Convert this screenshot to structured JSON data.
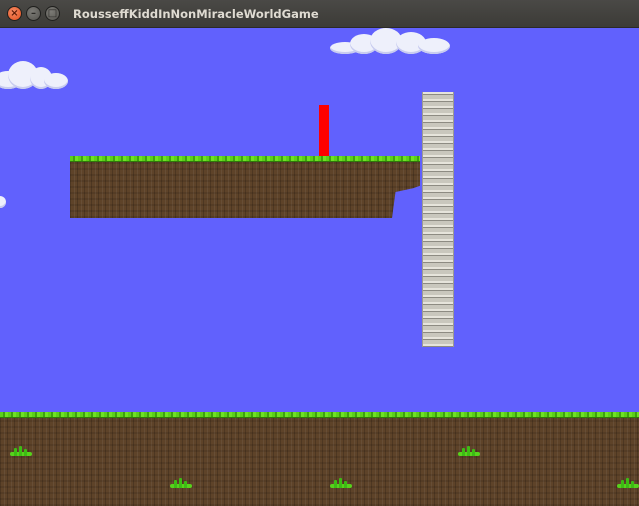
{
  "window": {
    "title": "RousseffKiddInNonMiracleWorldGame",
    "buttons": {
      "close_glyph": "×",
      "minimize_glyph": "–",
      "maximize_glyph": "□"
    }
  },
  "game": {
    "sky_color": "#6161fd",
    "player_color": "#fe0000",
    "grass_color": "#5ccf1a",
    "dirt_color": "#5e4329",
    "ladder_color": "#c9c7bd",
    "objects": [
      "cloud",
      "cloud",
      "cloud",
      "floating-platform",
      "player",
      "ladder",
      "ground",
      "grass-tuft"
    ]
  }
}
